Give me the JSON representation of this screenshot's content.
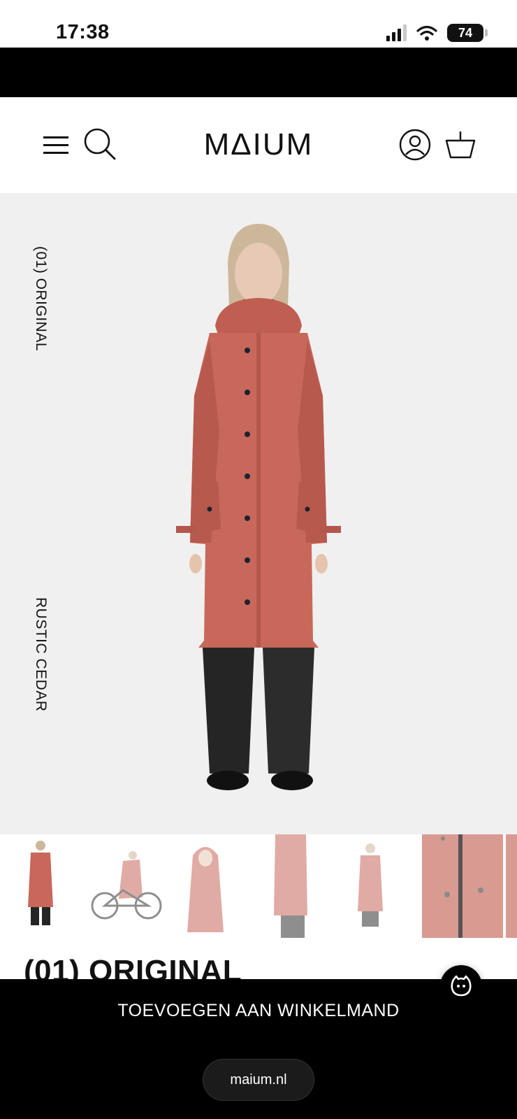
{
  "status_bar": {
    "time": "17:38",
    "battery": "74",
    "icons": [
      "signal-icon",
      "wifi-icon",
      "battery-icon"
    ]
  },
  "header": {
    "logo": "MΔIUM",
    "icons": [
      "menu-icon",
      "search-icon",
      "account-icon",
      "basket-icon"
    ]
  },
  "hero": {
    "label_top": "(01) ORIGINAL",
    "label_bottom": "RUSTIC CEDAR",
    "accent_color": "#c8685a"
  },
  "thumbnails": {
    "count": 7,
    "selected_index": 0
  },
  "product": {
    "title": "(01) ORIGINAL"
  },
  "actions": {
    "add_to_cart": "TOEVOEGEN AAN WINKELMAND"
  },
  "browser": {
    "url": "maium.nl"
  },
  "colors": {
    "coat": "#c8685a",
    "background_hero": "#f0f0f0",
    "bar": "#000000"
  }
}
